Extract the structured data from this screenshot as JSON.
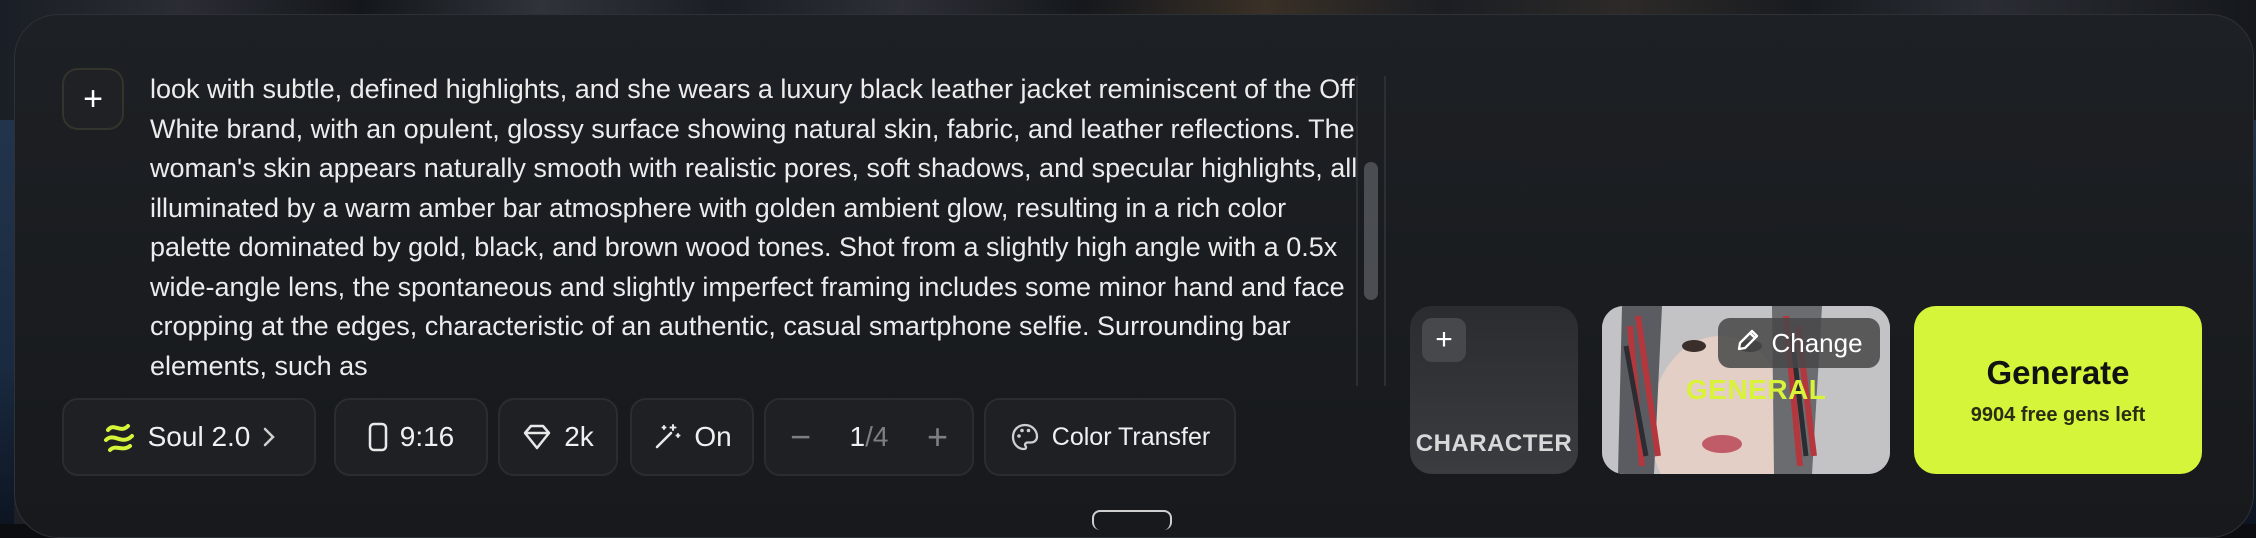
{
  "prompt": {
    "add_label": "+",
    "text": "look with subtle, defined highlights, and she wears a luxury black leather jacket reminiscent of the Off White brand, with an opulent, glossy surface showing natural skin, fabric, and leather reflections. The woman's skin appears naturally smooth with realistic pores, soft shadows, and specular highlights, all illuminated by a warm amber bar atmosphere with golden ambient glow, resulting in a rich color palette dominated by gold, black, and brown wood tones. Shot from a slightly high angle with a 0.5x wide-angle lens, the spontaneous and slightly imperfect framing includes some minor hand and face cropping at the edges, characteristic of an authentic, casual smartphone selfie. Surrounding bar elements, such as"
  },
  "toolbar": {
    "model": {
      "label": "Soul 2.0",
      "icon": "soul-logo-icon",
      "accent": "#d4f53a"
    },
    "aspect": {
      "label": "9:16",
      "icon": "phone-portrait-icon"
    },
    "quality": {
      "label": "2k",
      "icon": "diamond-icon"
    },
    "enhance": {
      "label": "On",
      "icon": "magic-wand-icon"
    },
    "count": {
      "current": "1",
      "total": "/4",
      "minus": "−",
      "plus": "+"
    },
    "color_transfer": {
      "label": "Color Transfer",
      "icon": "palette-icon"
    }
  },
  "character": {
    "add_label": "+",
    "label": "CHARACTER"
  },
  "style": {
    "label": "GENERAL",
    "change_label": "Change",
    "accent": "#d9f23a"
  },
  "generate": {
    "label": "Generate",
    "sub": "9904 free gens left",
    "color": "#d4f53a"
  }
}
